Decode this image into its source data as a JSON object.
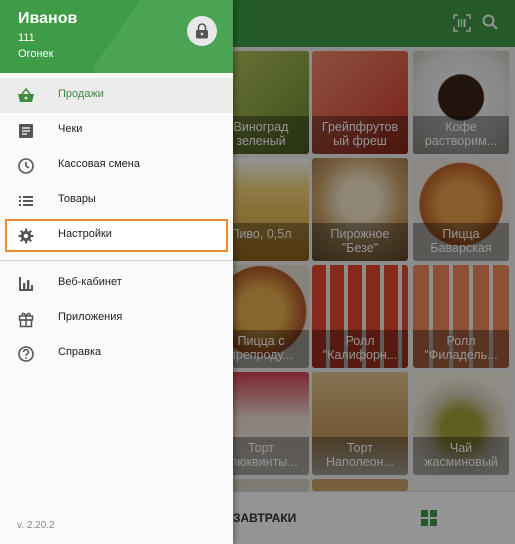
{
  "drawer": {
    "user_name": "Иванов",
    "user_id": "111",
    "store_name": "Огонек",
    "menu": [
      {
        "label": "Продажи",
        "icon": "basket-icon"
      },
      {
        "label": "Чеки",
        "icon": "receipt-icon"
      },
      {
        "label": "Кассовая смена",
        "icon": "clock-icon"
      },
      {
        "label": "Товары",
        "icon": "list-icon"
      },
      {
        "label": "Настройки",
        "icon": "gear-icon"
      },
      {
        "label": "Веб-кабинет",
        "icon": "bar-chart-icon"
      },
      {
        "label": "Приложения",
        "icon": "gift-icon"
      },
      {
        "label": "Справка",
        "icon": "help-icon"
      }
    ],
    "version": "v. 2.20.2"
  },
  "products": [
    {
      "name": "Виноград\nзеленый",
      "color": "#8aa64a"
    },
    {
      "name": "Грейпфрутов\nый фреш",
      "color": "#e0573a"
    },
    {
      "name": "Кофе\nрастворим...",
      "color": "#5a3a2a"
    },
    {
      "name": "Пиво, 0,5л",
      "color": "#d19a2c"
    },
    {
      "name": "Пирожное\n\"Безе\"",
      "color": "#c9a474"
    },
    {
      "name": "Пицца\nБаварская",
      "color": "#c77a3a"
    },
    {
      "name": "Пицца с\nпрепроду...",
      "color": "#b5652f"
    },
    {
      "name": "Ролл\n\"Калифорн...",
      "color": "#d0452f"
    },
    {
      "name": "Ролл\n\"Филадель...",
      "color": "#e07a4a"
    },
    {
      "name": "Торт\nклюквинты...",
      "color": "#c64a5a"
    },
    {
      "name": "Торт\nНаполеон...",
      "color": "#d4a66a"
    },
    {
      "name": "Чай\nжасминовый",
      "color": "#8a9a3a"
    }
  ],
  "bottom_bar": {
    "category": "ЗАВТРАКИ"
  },
  "colors": {
    "brand_green": "#3e9c47",
    "highlight": "#e98a35"
  }
}
